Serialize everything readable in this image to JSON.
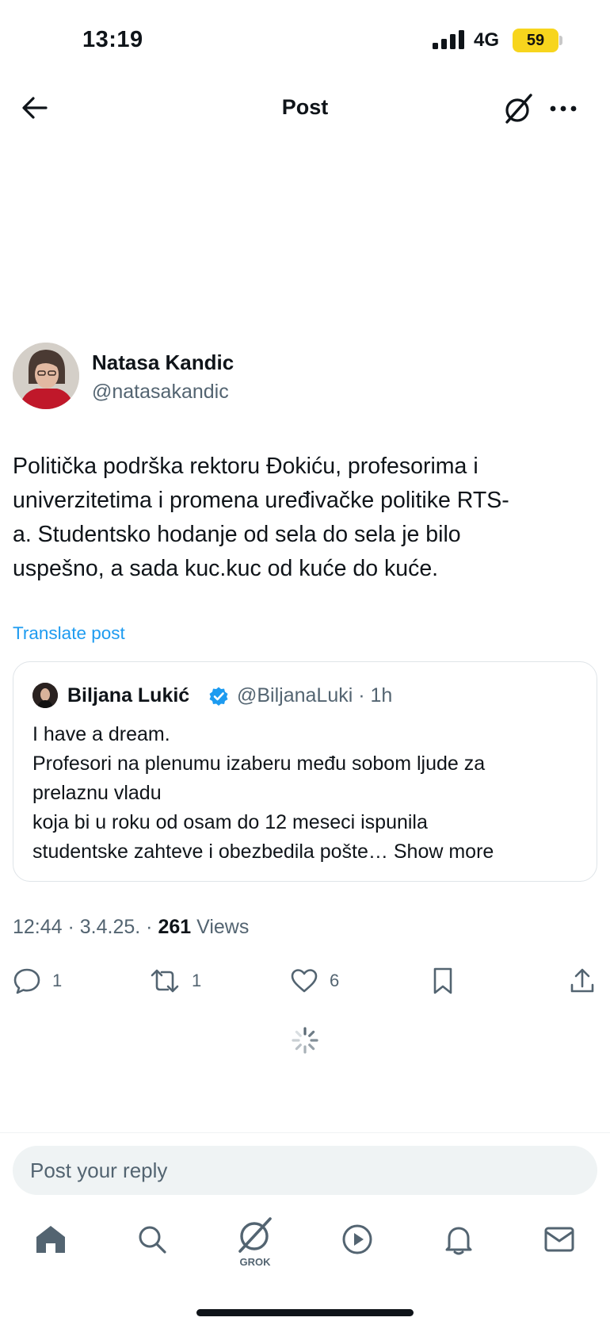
{
  "status_bar": {
    "time": "13:19",
    "network": "4G",
    "battery": "59"
  },
  "header": {
    "title": "Post",
    "back_icon": "arrow-left-icon",
    "grok_icon": "grok-icon",
    "more_icon": "more-horizontal-icon"
  },
  "post": {
    "author_name": "Natasa Kandic",
    "author_handle": "@natasakandic",
    "text": "Politička podrška rektoru Đokiću, profesorima i univerzitetima i promena uređivačke politike RTS-a. Studentsko hodanje od sela do sela je bilo uspešno, a sada kuc.kuc od kuće do kuće.",
    "text_lines": [
      "Politička podrška rektoru Đokiću, profesorima i",
      "univerzitetima i promena uređivačke politike RTS-",
      "a. Studentsko hodanje od sela do sela je bilo",
      "uspešno, a sada kuc.kuc od kuće do kuće."
    ],
    "translate_label": "Translate post",
    "time": "12:44",
    "date": "3.4.25.",
    "views_count": "261",
    "views_label": "Views"
  },
  "quote": {
    "author_name": "Biljana Lukić",
    "author_handle": "@BiljanaLuki",
    "age": "1h",
    "lines": [
      "I have a dream.",
      "Profesori na plenumu izaberu među sobom ljude za",
      "prelaznu vladu",
      "koja bi u roku od osam do 12 meseci ispunila",
      "studentske zahteve i obezbedila pošte…"
    ],
    "show_more": "Show more"
  },
  "actions": {
    "replies": "1",
    "reposts": "1",
    "likes": "6"
  },
  "reply_box": {
    "placeholder": "Post your reply"
  },
  "tabbar": {
    "grok_label": "GROK",
    "items": [
      "home-icon",
      "search-icon",
      "grok-icon",
      "video-play-icon",
      "notifications-bell-icon",
      "messages-envelope-icon"
    ]
  },
  "colors": {
    "accent": "#1d9bf0",
    "secondary_text": "#536471",
    "battery": "#f7d51d",
    "verified": "#1d9bf0"
  }
}
